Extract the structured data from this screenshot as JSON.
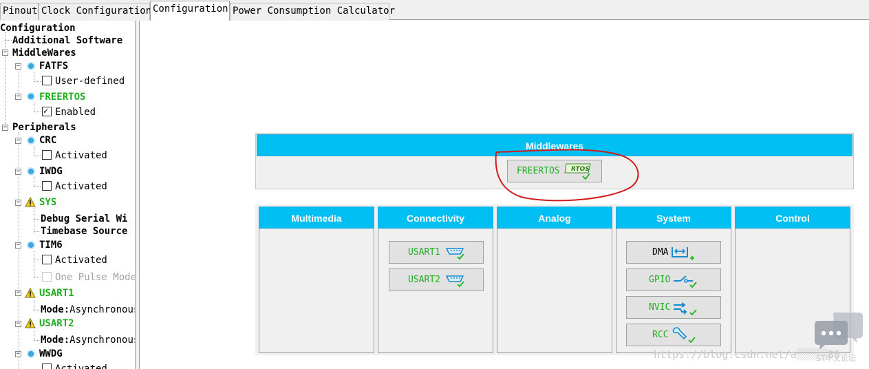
{
  "tabs": [
    "Pinout",
    "Clock Configuration",
    "Configuration",
    "Power Consumption Calculator"
  ],
  "tree": {
    "root": "Configuration",
    "additional_software": "Additional Software",
    "middlewares": "MiddleWares",
    "fatfs": {
      "label": "FATFS",
      "option": "User-defined"
    },
    "freertos": {
      "label": "FREERTOS",
      "option": "Enabled"
    },
    "peripherals": "Peripherals",
    "crc": {
      "label": "CRC",
      "option": "Activated"
    },
    "iwdg": {
      "label": "IWDG",
      "option": "Activated"
    },
    "sys": {
      "label": "SYS",
      "item1": "Debug Serial Wi",
      "item2": "Timebase Source"
    },
    "tim6": {
      "label": "TIM6",
      "option1": "Activated",
      "option2": "One Pulse Mode"
    },
    "usart1": {
      "label": "USART1",
      "mode_label": "Mode:",
      "mode_value": "Asynchronous"
    },
    "usart2": {
      "label": "USART2",
      "mode_label": "Mode:",
      "mode_value": "Asynchronous"
    },
    "wwdg": {
      "label": "WWDG",
      "option": "Activated"
    }
  },
  "middlewares_panel": {
    "title": "Middlewares",
    "button": "FREERTOS",
    "badge": "RTOS"
  },
  "categories": {
    "multimedia": "Multimedia",
    "connectivity": {
      "title": "Connectivity",
      "buttons": [
        "USART1",
        "USART2"
      ]
    },
    "analog": "Analog",
    "system": {
      "title": "System",
      "buttons": [
        "DMA",
        "GPIO",
        "NVIC",
        "RCC"
      ]
    },
    "control": "Control"
  },
  "watermark": {
    "url": "https://blog.csdn.net/a",
    "suffix": "86",
    "site": "ST中文论坛"
  },
  "colors": {
    "header": "#00bff3",
    "green_text": "#1fae1f",
    "annotation": "#d21a1a"
  }
}
